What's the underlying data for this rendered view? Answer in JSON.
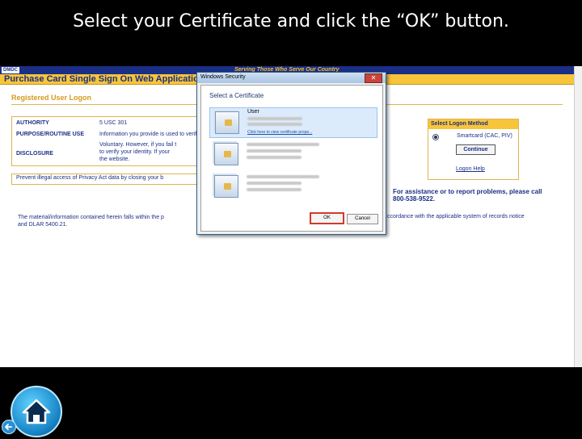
{
  "slide": {
    "title": "Select your Certificate and click the “OK” button."
  },
  "app": {
    "logo_text": "DMDC",
    "tagline": "Serving Those Who Serve Our Country",
    "title": "Purchase Card Single Sign On Web Application",
    "page_title": "Registered User Logon"
  },
  "privacy": {
    "authority_label": "AUTHORITY",
    "authority_value": "5 USC 301",
    "purpose_label": "PURPOSE/ROUTINE USE",
    "purpose_value_1": "Information you provide is used to verify your identity and usage of this website.",
    "purpose_value_2": "Voluntary. However, if you fail t",
    "disclosure_label": "DISCLOSURE",
    "disclosure_value_1": "to verify your identity. If your",
    "disclosure_value_2": "the website.",
    "warning": "Prevent illegal access of Privacy Act data by closing your b"
  },
  "logon": {
    "header": "Select Logon Method",
    "option": "Smartcard (CAC, PIV)",
    "continue_label": "Continue",
    "help_label": "Logon Help"
  },
  "assistance": {
    "line1": "For assistance or to report problems, please call",
    "line2": "800-538-9522."
  },
  "material": {
    "line1": "The material/information contained herein falls within the p",
    "line2": "and DLAR 5400.21.",
    "line1_right": "ccordance with the applicable system of records notice"
  },
  "dialog": {
    "title": "Windows Security",
    "close_glyph": "✕",
    "subtitle": "Select a Certificate",
    "certs": [
      {
        "name": "User",
        "link": "Click here to view certificate prope..."
      },
      {
        "name": ""
      },
      {
        "name": ""
      }
    ],
    "ok_label": "OK",
    "cancel_label": "Cancel"
  },
  "icons": {
    "home": "home-icon",
    "back": "back-arrow-icon"
  }
}
